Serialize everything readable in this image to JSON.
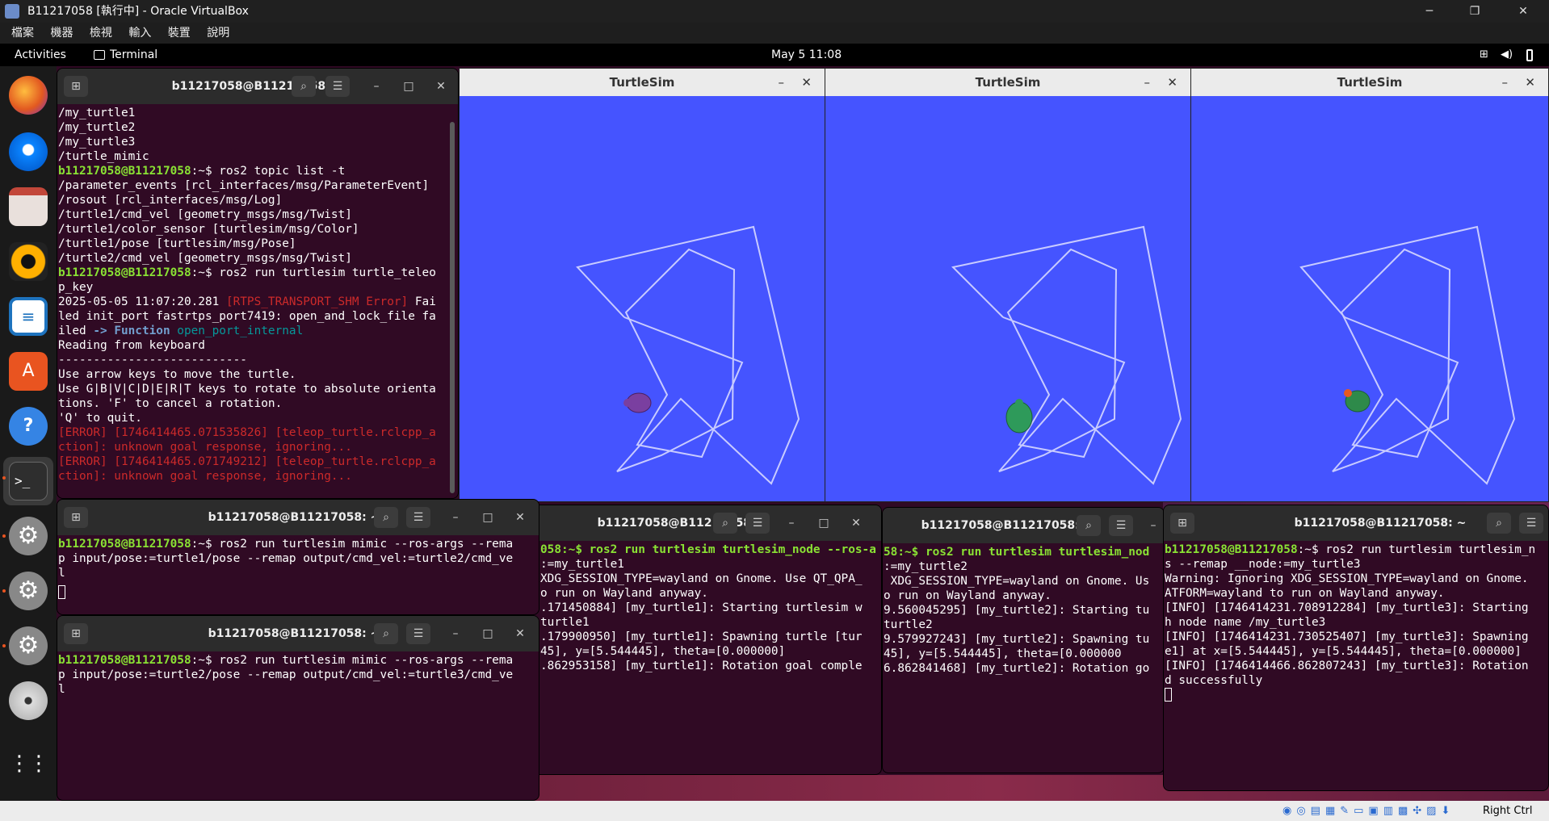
{
  "vbox": {
    "title": "B11217058 [執行中] - Oracle VirtualBox",
    "min": "─",
    "max": "❐",
    "close": "✕",
    "menu": [
      "檔案",
      "機器",
      "檢視",
      "輸入",
      "裝置",
      "說明"
    ]
  },
  "gnome": {
    "activities": "Activities",
    "app": "Terminal",
    "clock": "May 5  11:08"
  },
  "dock": {
    "apps": [
      "firefox",
      "thunderbird",
      "files",
      "rhythmbox",
      "writer",
      "software",
      "help",
      "terminal",
      "settings",
      "settings",
      "settings",
      "dvd",
      "app-grid"
    ]
  },
  "turtlesim": {
    "title": "TurtleSim",
    "path_color": "#c8cbff",
    "bg": "#4554ff"
  },
  "term_main": {
    "title": "b11217058@B11217058: ~",
    "prompt": "b11217058@B11217058",
    "suffix": ":~$ ",
    "l1": "/my_turtle1",
    "l2": "/my_turtle2",
    "l3": "/my_turtle3",
    "l4": "/turtle_mimic",
    "cmd1": "ros2 topic list -t",
    "t1": "/parameter_events [rcl_interfaces/msg/ParameterEvent]",
    "t2": "/rosout [rcl_interfaces/msg/Log]",
    "t3": "/turtle1/cmd_vel [geometry_msgs/msg/Twist]",
    "t4": "/turtle1/color_sensor [turtlesim/msg/Color]",
    "t5": "/turtle1/pose [turtlesim/msg/Pose]",
    "t6": "/turtle2/cmd_vel [geometry_msgs/msg/Twist]",
    "cmd2": "ros2 run turtlesim turtle_teleo",
    "cmd2b": "p_key",
    "ts": "2025-05-05 11:07:20.281 ",
    "shm": "[RTPS_TRANSPORT_SHM ",
    "err": "Error]",
    "fai": " Fai",
    "e1": "led init_port fastrtps_port7419: open_and_lock_file fa",
    "e2a": "iled ",
    "arrow": "-> Function ",
    "fn": "open_port_internal",
    "r1": "Reading from keyboard",
    "r2": "---------------------------",
    "r3": "Use arrow keys to move the turtle.",
    "r4": "Use G|B|V|C|D|E|R|T keys to rotate to absolute orienta",
    "r5": "tions. 'F' to cancel a rotation.",
    "r6": "'Q' to quit.",
    "x1": "[ERROR] [1746414465.071535826] [teleop_turtle.rclcpp_a",
    "x2": "ction]: unknown goal response, ignoring...",
    "x3": "[ERROR] [1746414465.071749212] [teleop_turtle.rclcpp_a",
    "x4": "ction]: unknown goal response, ignoring..."
  },
  "term_m1": {
    "title": "b11217058@B11217058: ~",
    "c1": "ros2 run turtlesim mimic --ros-args --rema",
    "c2": "p input/pose:=turtle1/pose --remap output/cmd_vel:=turtle2/cmd_ve",
    "c3": "l"
  },
  "term_m2": {
    "title": "b11217058@B11217058: ~",
    "c1": "ros2 run turtlesim mimic --ros-args --rema",
    "c2": "p input/pose:=turtle2/pose --remap output/cmd_vel:=turtle3/cmd_ve",
    "c3": "l"
  },
  "term_n1": {
    "title": "b11217058@B11217058: ~",
    "l1": "058:~$ ros2 run turtlesim turtlesim_node --ros-a",
    "l2": ":=my_turtle1",
    "l3": "XDG_SESSION_TYPE=wayland on Gnome. Use QT_QPA_",
    "l4": "o run on Wayland anyway.",
    "l5": ".171450884] [my_turtle1]: Starting turtlesim w",
    "l6": "turtle1",
    "l7": ".179900950] [my_turtle1]: Spawning turtle [tur",
    "l8": "45], y=[5.544445], theta=[0.000000]",
    "l9": ".862953158] [my_turtle1]: Rotation goal comple"
  },
  "term_n2": {
    "title": "b11217058@B11217058: ~",
    "l1": "58:~$ ros2 run turtlesim turtlesim_nod",
    "l2": ":=my_turtle2",
    "l3": " XDG_SESSION_TYPE=wayland on Gnome. Us",
    "l4": "o run on Wayland anyway.",
    "l5": "9.560045295] [my_turtle2]: Starting tu",
    "l6": "turtle2",
    "l7": "9.579927243] [my_turtle2]: Spawning tu",
    "l8": "45], y=[5.544445], theta=[0.000000",
    "l9": "6.862841468] [my_turtle2]: Rotation go"
  },
  "term_n3": {
    "title": "b11217058@B11217058: ~",
    "c1": "ros2 run turtlesim turtlesim_n",
    "l2": "s --remap __node:=my_turtle3",
    "l3": "Warning: Ignoring XDG_SESSION_TYPE=wayland on Gnome.",
    "l4": "ATFORM=wayland to run on Wayland anyway.",
    "l5": "[INFO] [1746414231.708912284] [my_turtle3]: Starting",
    "l6": "h node name /my_turtle3",
    "l7": "[INFO] [1746414231.730525407] [my_turtle3]: Spawning",
    "l8": "e1] at x=[5.544445], y=[5.544445], theta=[0.000000]",
    "l9": "[INFO] [1746414466.862807243] [my_turtle3]: Rotation",
    "l10": "d successfully"
  },
  "statusbar": {
    "host_key": "Right Ctrl"
  }
}
